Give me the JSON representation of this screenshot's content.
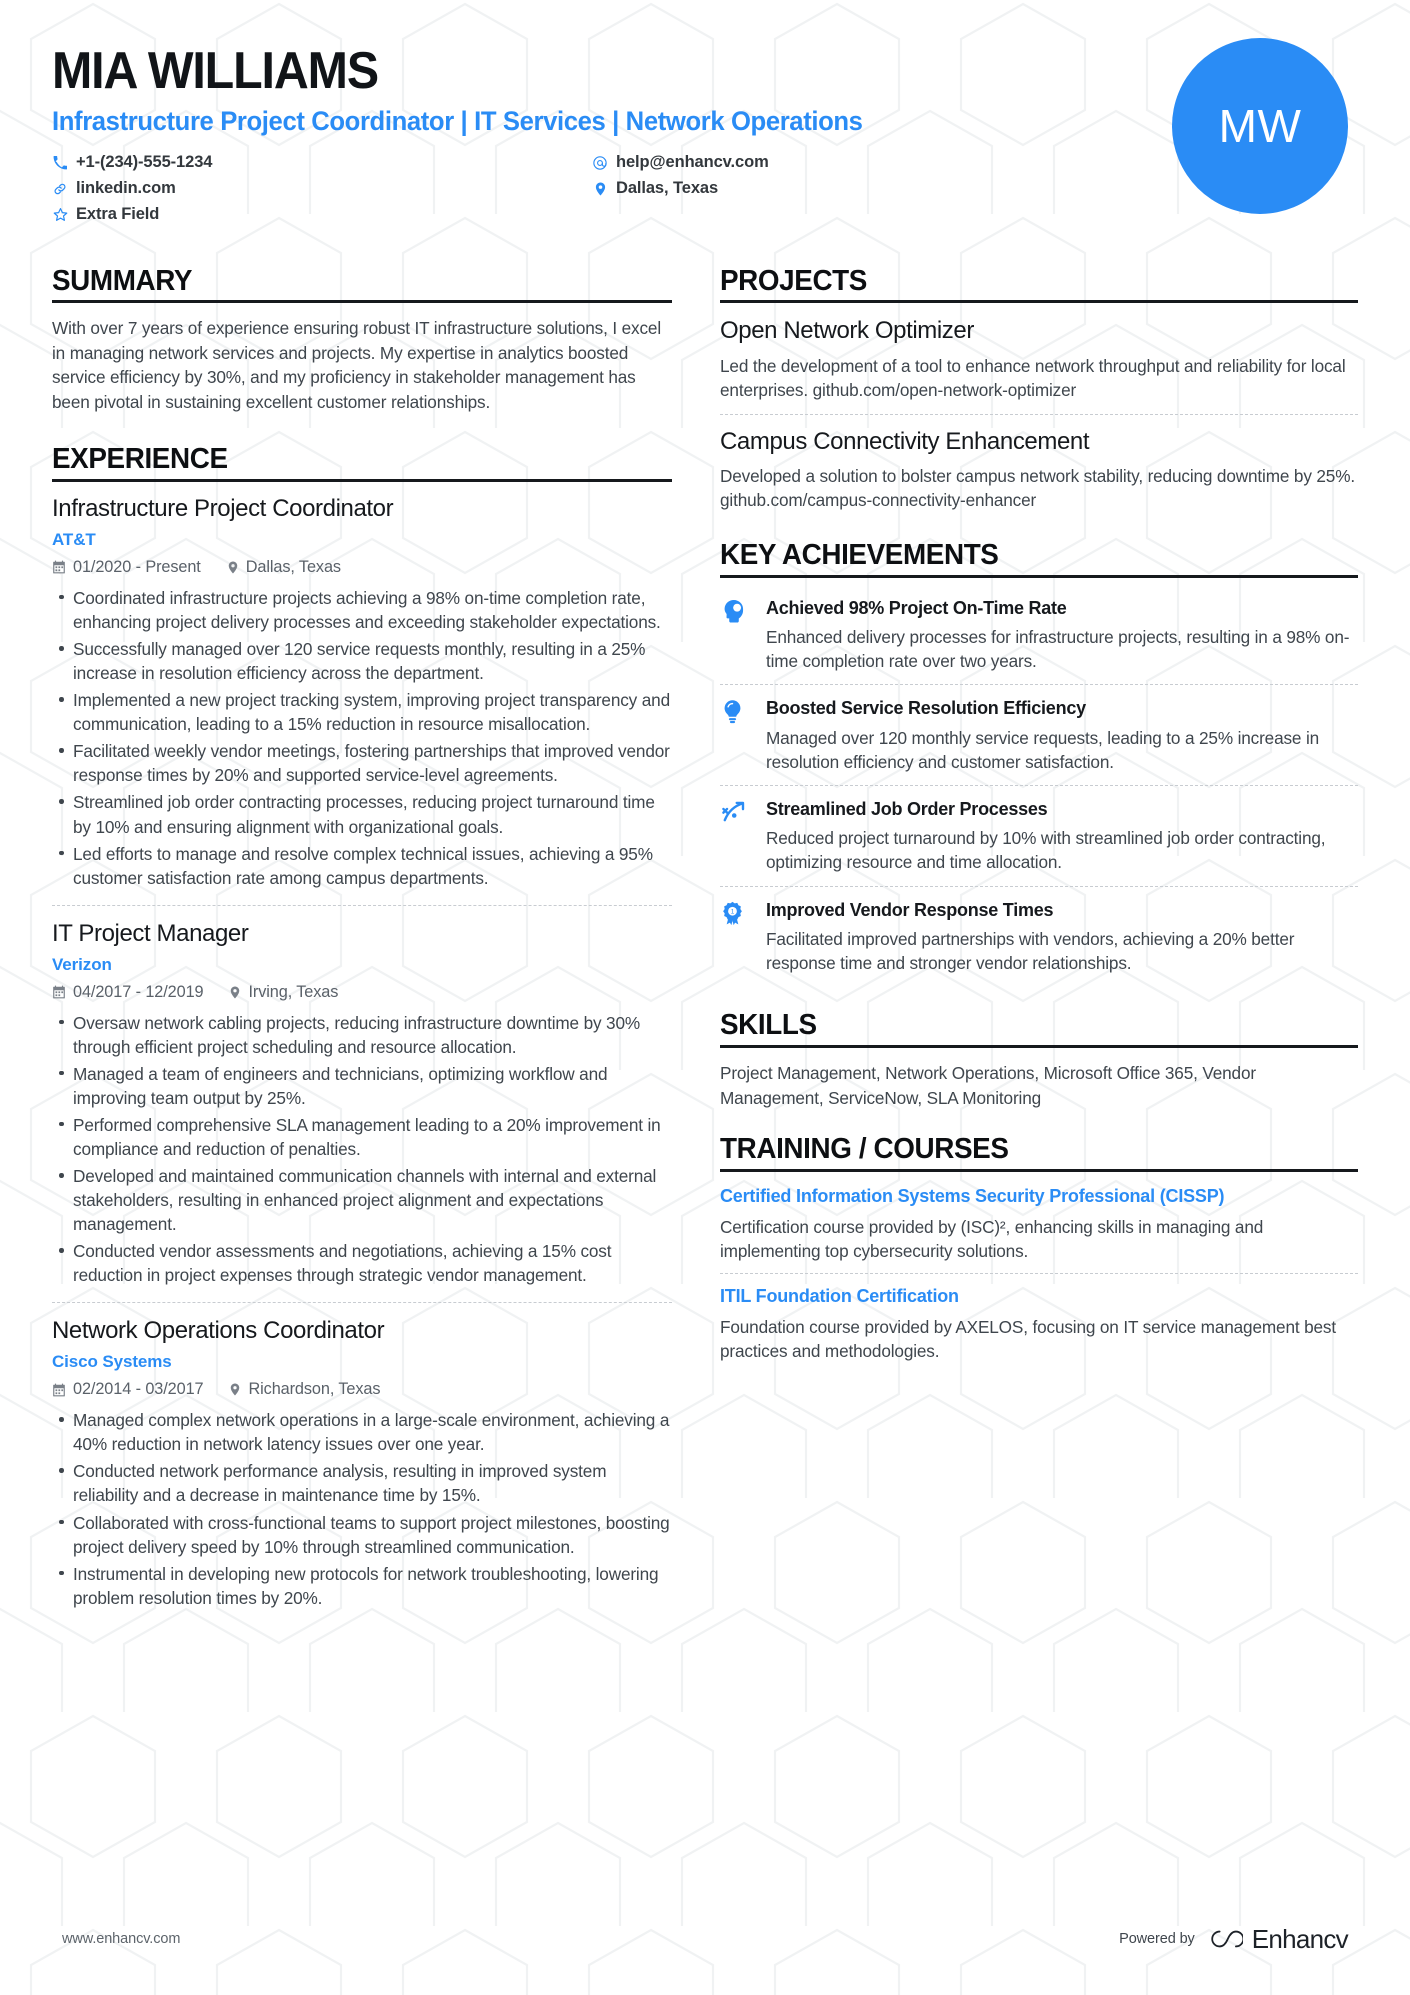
{
  "theme": {
    "accent": "#2a8cf5",
    "ink": "#16191d",
    "body_text": "#3f464d"
  },
  "header": {
    "name": "MIA WILLIAMS",
    "headline": "Infrastructure Project Coordinator | IT Services | Network Operations",
    "avatar_initials": "MW",
    "contacts": [
      {
        "icon": "phone-icon",
        "text": "+1-(234)-555-1234"
      },
      {
        "icon": "email-icon",
        "text": "help@enhancv.com"
      },
      {
        "icon": "link-icon",
        "text": "linkedin.com"
      },
      {
        "icon": "location-pin-icon",
        "text": "Dallas, Texas"
      },
      {
        "icon": "star-icon",
        "text": "Extra Field"
      }
    ]
  },
  "summary": {
    "title": "SUMMARY",
    "text": "With over 7 years of experience ensuring robust IT infrastructure solutions, I excel in managing network services and projects. My expertise in analytics boosted service efficiency by 30%, and my proficiency in stakeholder management has been pivotal in sustaining excellent customer relationships."
  },
  "experience": {
    "title": "EXPERIENCE",
    "jobs": [
      {
        "role": "Infrastructure Project Coordinator",
        "company": "AT&T",
        "dates": "01/2020 - Present",
        "location": "Dallas, Texas",
        "bullets": [
          "Coordinated infrastructure projects achieving a 98% on-time completion rate, enhancing project delivery processes and exceeding stakeholder expectations.",
          "Successfully managed over 120 service requests monthly, resulting in a 25% increase in resolution efficiency across the department.",
          "Implemented a new project tracking system, improving project transparency and communication, leading to a 15% reduction in resource misallocation.",
          "Facilitated weekly vendor meetings, fostering partnerships that improved vendor response times by 20% and supported service-level agreements.",
          "Streamlined job order contracting processes, reducing project turnaround time by 10% and ensuring alignment with organizational goals.",
          "Led efforts to manage and resolve complex technical issues, achieving a 95% customer satisfaction rate among campus departments."
        ]
      },
      {
        "role": "IT Project Manager",
        "company": "Verizon",
        "dates": "04/2017 - 12/2019",
        "location": "Irving, Texas",
        "bullets": [
          "Oversaw network cabling projects, reducing infrastructure downtime by 30% through efficient project scheduling and resource allocation.",
          "Managed a team of engineers and technicians, optimizing workflow and improving team output by 25%.",
          "Performed comprehensive SLA management leading to a 20% improvement in compliance and reduction of penalties.",
          "Developed and maintained communication channels with internal and external stakeholders, resulting in enhanced project alignment and expectations management.",
          "Conducted vendor assessments and negotiations, achieving a 15% cost reduction in project expenses through strategic vendor management."
        ]
      },
      {
        "role": "Network Operations Coordinator",
        "company": "Cisco Systems",
        "dates": "02/2014 - 03/2017",
        "location": "Richardson, Texas",
        "bullets": [
          "Managed complex network operations in a large-scale environment, achieving a 40% reduction in network latency issues over one year.",
          "Conducted network performance analysis, resulting in improved system reliability and a decrease in maintenance time by 15%.",
          "Collaborated with cross-functional teams to support project milestones, boosting project delivery speed by 10% through streamlined communication.",
          "Instrumental in developing new protocols for network troubleshooting, lowering problem resolution times by 20%."
        ]
      }
    ]
  },
  "projects": {
    "title": "PROJECTS",
    "items": [
      {
        "name": "Open Network Optimizer",
        "description": "Led the development of a tool to enhance network throughput and reliability for local enterprises. github.com/open-network-optimizer"
      },
      {
        "name": "Campus Connectivity Enhancement",
        "description": "Developed a solution to bolster campus network stability, reducing downtime by 25%. github.com/campus-connectivity-enhancer"
      }
    ]
  },
  "achievements": {
    "title": "KEY ACHIEVEMENTS",
    "items": [
      {
        "icon": "head-profile-icon",
        "title": "Achieved 98% Project On-Time Rate",
        "description": "Enhanced delivery processes for infrastructure projects, resulting in a 98% on-time completion rate over two years."
      },
      {
        "icon": "lightbulb-icon",
        "title": "Boosted Service Resolution Efficiency",
        "description": "Managed over 120 monthly service requests, leading to a 25% increase in resolution efficiency and customer satisfaction."
      },
      {
        "icon": "trajectory-arrow-icon",
        "title": "Streamlined Job Order Processes",
        "description": "Reduced project turnaround by 10% with streamlined job order contracting, optimizing resource and time allocation."
      },
      {
        "icon": "award-ribbon-icon",
        "title": "Improved Vendor Response Times",
        "description": "Facilitated improved partnerships with vendors, achieving a 20% better response time and stronger vendor relationships."
      }
    ]
  },
  "skills": {
    "title": "SKILLS",
    "text": "Project Management, Network Operations, Microsoft Office 365, Vendor Management, ServiceNow, SLA Monitoring"
  },
  "training": {
    "title": "TRAINING / COURSES",
    "items": [
      {
        "name": "Certified Information Systems Security Professional (CISSP)",
        "description": "Certification course provided by (ISC)², enhancing skills in managing and implementing top cybersecurity solutions."
      },
      {
        "name": "ITIL Foundation Certification",
        "description": "Foundation course provided by AXELOS, focusing on IT service management best practices and methodologies."
      }
    ]
  },
  "footer": {
    "url": "www.enhancv.com",
    "powered_by": "Powered by",
    "brand": "Enhancv"
  }
}
